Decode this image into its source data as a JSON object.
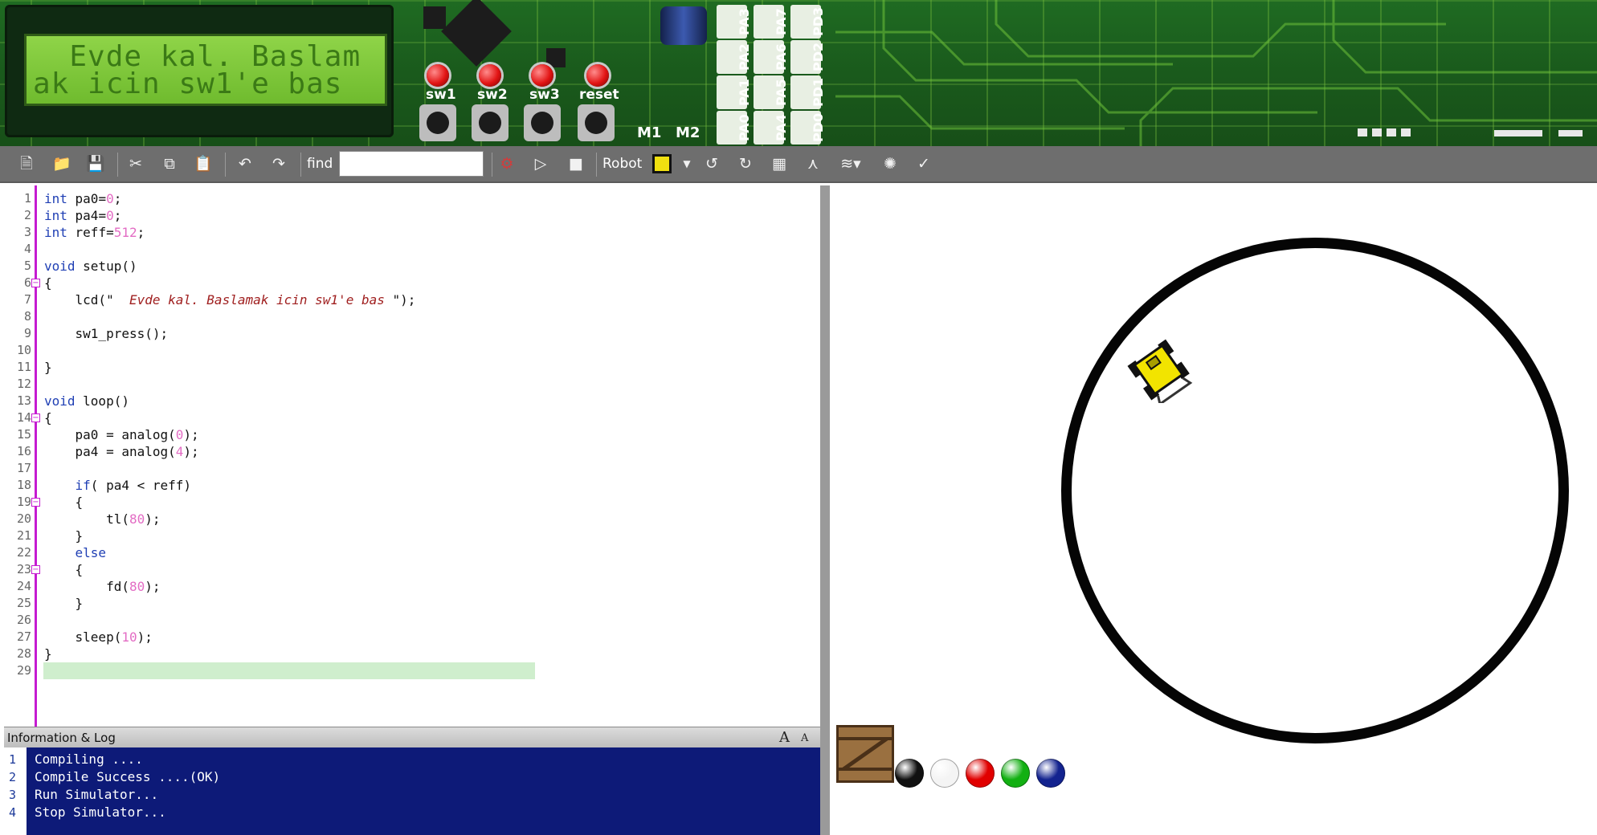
{
  "board": {
    "lcd": {
      "line1": "  Evde kal. Baslam",
      "line2": "ak icin sw1'e bas"
    },
    "buttons": [
      {
        "label": "sw1"
      },
      {
        "label": "sw2"
      },
      {
        "label": "sw3"
      },
      {
        "label": "reset"
      }
    ],
    "motors": [
      "M1",
      "M2"
    ],
    "ports": [
      "PA3",
      "PA7",
      "PD3",
      "PA2",
      "PA6",
      "PD2",
      "PA1",
      "PA5",
      "PD1",
      "PA0",
      "PA4",
      "PD0"
    ]
  },
  "toolbar": {
    "find_label": "find",
    "find_value": "",
    "robot_label": "Robot",
    "icons": [
      "new-file-icon",
      "open-folder-icon",
      "save-icon",
      "cut-icon",
      "copy-icon",
      "paste-icon",
      "undo-icon",
      "redo-icon",
      "compile-gear-icon",
      "run-icon",
      "stop-icon",
      "robot-icon",
      "rotate-left-icon",
      "rotate-right-icon",
      "calculator-icon",
      "tree-icon",
      "track-icon",
      "sensor-icon",
      "help-icon"
    ]
  },
  "editor": {
    "line_numbers": [
      "1",
      "2",
      "3",
      "4",
      "5",
      "6",
      "7",
      "8",
      "9",
      "10",
      "11",
      "12",
      "13",
      "14",
      "15",
      "16",
      "17",
      "18",
      "19",
      "20",
      "21",
      "22",
      "23",
      "24",
      "25",
      "26",
      "27",
      "28",
      "29"
    ],
    "current_line": "29",
    "lines": [
      {
        "kw": "int",
        "rest": " pa0=",
        "num": "0",
        "end": ";"
      },
      {
        "kw": "int",
        "rest": " pa4=",
        "num": "0",
        "end": ";"
      },
      {
        "kw": "int",
        "rest": " reff=",
        "num": "512",
        "end": ";"
      },
      {},
      {
        "kw": "void",
        "rest": " setup()"
      },
      {
        "rest": "{"
      },
      {
        "rest": "    lcd(\"",
        "str": "  Evde kal. Baslamak icin sw1'e bas ",
        "end": "\");"
      },
      {},
      {
        "rest": "    sw1_press();"
      },
      {},
      {
        "rest": "}"
      },
      {},
      {
        "kw": "void",
        "rest": " loop()"
      },
      {
        "rest": "{"
      },
      {
        "rest": "    pa0 = analog(",
        "num": "0",
        "end": ");"
      },
      {
        "rest": "    pa4 = analog(",
        "num": "4",
        "end": ");"
      },
      {},
      {
        "pre": "    ",
        "kw": "if",
        "rest": "( pa4 < reff)"
      },
      {
        "rest": "    {"
      },
      {
        "rest": "        tl(",
        "num": "80",
        "end": ");"
      },
      {
        "rest": "    }"
      },
      {
        "pre": "    ",
        "kw": "else"
      },
      {
        "rest": "    {"
      },
      {
        "rest": "        fd(",
        "num": "80",
        "end": ");"
      },
      {
        "rest": "    }"
      },
      {},
      {
        "rest": "    sleep(",
        "num": "10",
        "end": ");"
      },
      {
        "rest": "}"
      },
      {}
    ]
  },
  "log": {
    "title": "Information & Log",
    "font_up": "A",
    "font_down": "A",
    "lines": [
      {
        "n": "1",
        "text": "Compiling ...."
      },
      {
        "n": "2",
        "text": "Compile Success ....(OK)"
      },
      {
        "n": "3",
        "text": "Run Simulator..."
      },
      {
        "n": "4",
        "text": "Stop Simulator..."
      }
    ]
  },
  "simulator": {
    "track_color": "#050505",
    "robot_color": "#f2e400",
    "palette": [
      {
        "name": "black",
        "color": "#111111"
      },
      {
        "name": "white",
        "color": "#f4f4f4"
      },
      {
        "name": "red",
        "color": "#e10000"
      },
      {
        "name": "green",
        "color": "#12b012"
      },
      {
        "name": "blue",
        "color": "#13238f"
      }
    ]
  }
}
